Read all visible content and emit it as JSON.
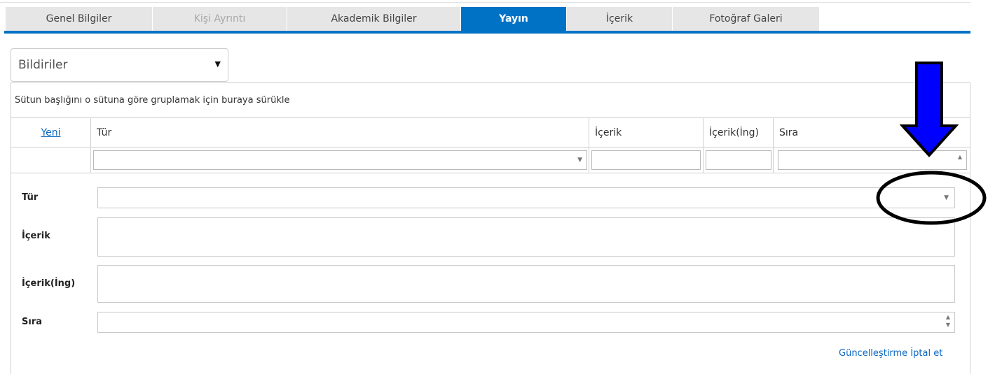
{
  "tabs": [
    {
      "label": "Genel Bilgiler",
      "state": "normal"
    },
    {
      "label": "Kişi Ayrıntı",
      "state": "disabled"
    },
    {
      "label": "Akademik Bilgiler",
      "state": "normal"
    },
    {
      "label": "Yayın",
      "state": "active"
    },
    {
      "label": "İçerik",
      "state": "normal"
    },
    {
      "label": "Fotoğraf Galeri",
      "state": "normal"
    }
  ],
  "type_select": {
    "value": "Bildiriler",
    "caret": "▼"
  },
  "grid": {
    "group_panel_text": "Sütun başlığını o sütuna göre gruplamak için buraya sürükle",
    "new_link": "Yeni",
    "columns": [
      "Tür",
      "İçerik",
      "İçerik(İng)",
      "Sıra"
    ]
  },
  "form": {
    "labels": {
      "tur": "Tür",
      "icerik": "İçerik",
      "icerik_ing": "İçerik(İng)",
      "sira": "Sıra"
    }
  },
  "actions": {
    "update": "Güncelleştirme",
    "cancel": "İptal et"
  },
  "colors": {
    "accent": "#0072c6",
    "annotation_arrow": "#0000ff"
  },
  "icons": {
    "dropdown_caret": "caret-down-icon",
    "spinner": "spinner-icon"
  }
}
